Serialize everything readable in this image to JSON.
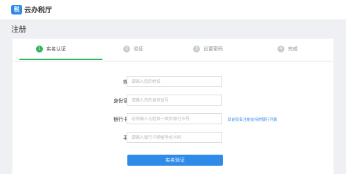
{
  "app": {
    "name": "云办税厅",
    "logo_icon": "税"
  },
  "page": {
    "title": "注册"
  },
  "steps": [
    {
      "num": "1",
      "label": "实名认证",
      "active": true
    },
    {
      "num": "2",
      "label": "验证",
      "active": false
    },
    {
      "num": "3",
      "label": "设置密码",
      "active": false
    },
    {
      "num": "4",
      "label": "完成",
      "active": false
    }
  ],
  "form": {
    "name": {
      "label": "姓名：",
      "placeholder": "请输入您的姓名",
      "value": ""
    },
    "id_number": {
      "label": "身份证号：",
      "placeholder": "请输入您的身份证号",
      "value": ""
    },
    "bank_card": {
      "label": "银行卡号：",
      "placeholder": "必须输入与姓名一致的银行卡号",
      "value": "",
      "link": "目前实名注册支持的银行列表"
    },
    "phone": {
      "label": "手机：",
      "placeholder": "请输入银行卡预留手机号码",
      "value": ""
    },
    "submit_label": "实名验证"
  },
  "colors": {
    "accent_blue": "#2e8be8",
    "active_green": "#2db35a",
    "background": "#eef0f3"
  }
}
